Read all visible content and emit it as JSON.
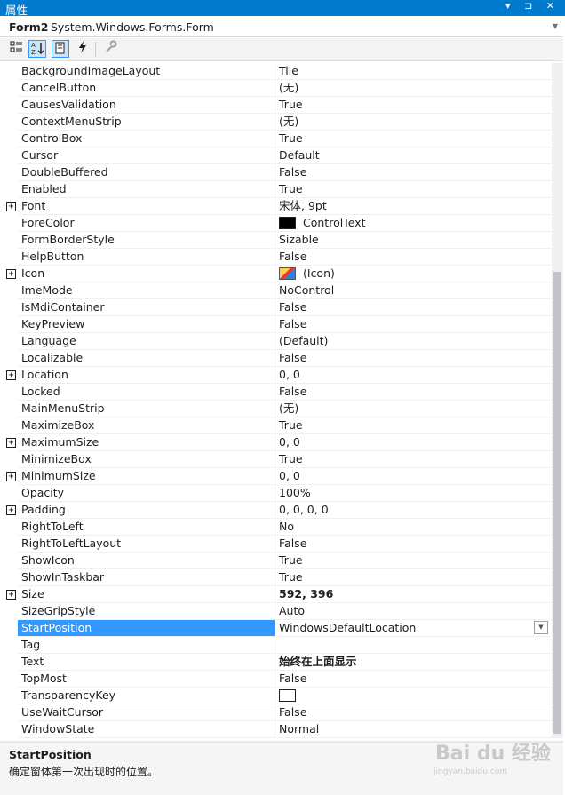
{
  "titlebar": {
    "title": "属性",
    "controls": "▾ ⊐ ✕"
  },
  "object_selector": {
    "name": "Form2",
    "type": "System.Windows.Forms.Form"
  },
  "toolbar": {
    "categorized_icon": "categorized-icon",
    "alphabetical_icon": "alphabetical-icon",
    "properties_icon": "property-pages-icon",
    "events_icon": "lightning-icon",
    "pages_icon": "wrench-icon"
  },
  "properties": [
    {
      "name": "BackgroundImageLayout",
      "value": "Tile"
    },
    {
      "name": "CancelButton",
      "value": "(无)"
    },
    {
      "name": "CausesValidation",
      "value": "True"
    },
    {
      "name": "ContextMenuStrip",
      "value": "(无)"
    },
    {
      "name": "ControlBox",
      "value": "True"
    },
    {
      "name": "Cursor",
      "value": "Default"
    },
    {
      "name": "DoubleBuffered",
      "value": "False"
    },
    {
      "name": "Enabled",
      "value": "True"
    },
    {
      "name": "Font",
      "value": "宋体, 9pt",
      "expand": true
    },
    {
      "name": "ForeColor",
      "value": "ControlText",
      "swatch": "#000000"
    },
    {
      "name": "FormBorderStyle",
      "value": "Sizable"
    },
    {
      "name": "HelpButton",
      "value": "False"
    },
    {
      "name": "Icon",
      "value": "(Icon)",
      "expand": true,
      "icon": true
    },
    {
      "name": "ImeMode",
      "value": "NoControl"
    },
    {
      "name": "IsMdiContainer",
      "value": "False"
    },
    {
      "name": "KeyPreview",
      "value": "False"
    },
    {
      "name": "Language",
      "value": "(Default)"
    },
    {
      "name": "Localizable",
      "value": "False"
    },
    {
      "name": "Location",
      "value": "0, 0",
      "expand": true
    },
    {
      "name": "Locked",
      "value": "False"
    },
    {
      "name": "MainMenuStrip",
      "value": "(无)"
    },
    {
      "name": "MaximizeBox",
      "value": "True"
    },
    {
      "name": "MaximumSize",
      "value": "0, 0",
      "expand": true
    },
    {
      "name": "MinimizeBox",
      "value": "True"
    },
    {
      "name": "MinimumSize",
      "value": "0, 0",
      "expand": true
    },
    {
      "name": "Opacity",
      "value": "100%"
    },
    {
      "name": "Padding",
      "value": "0, 0, 0, 0",
      "expand": true
    },
    {
      "name": "RightToLeft",
      "value": "No"
    },
    {
      "name": "RightToLeftLayout",
      "value": "False"
    },
    {
      "name": "ShowIcon",
      "value": "True"
    },
    {
      "name": "ShowInTaskbar",
      "value": "True"
    },
    {
      "name": "Size",
      "value": "592, 396",
      "expand": true,
      "bold": true
    },
    {
      "name": "SizeGripStyle",
      "value": "Auto"
    },
    {
      "name": "StartPosition",
      "value": "WindowsDefaultLocation",
      "selected": true,
      "dropdown": true
    },
    {
      "name": "Tag",
      "value": ""
    },
    {
      "name": "Text",
      "value": "始终在上面显示",
      "bold": true
    },
    {
      "name": "TopMost",
      "value": "False"
    },
    {
      "name": "TransparencyKey",
      "value": "",
      "swatch": "#ffffff"
    },
    {
      "name": "UseWaitCursor",
      "value": "False"
    },
    {
      "name": "WindowState",
      "value": "Normal"
    }
  ],
  "description": {
    "title": "StartPosition",
    "text": "确定窗体第一次出现时的位置。"
  },
  "watermark": {
    "logo": "Bai du 经验",
    "url": "jingyan.baidu.com"
  },
  "colors": {
    "accent": "#007acc",
    "selection": "#3399ff"
  }
}
